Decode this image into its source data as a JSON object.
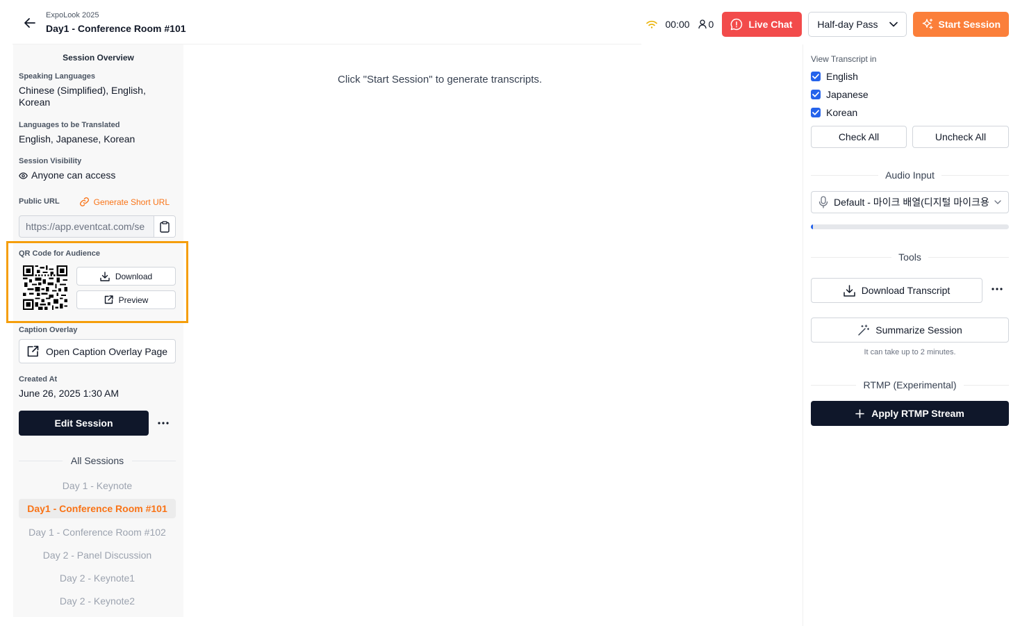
{
  "header": {
    "event_name": "ExpoLook 2025",
    "session_title": "Day1 - Conference Room #101",
    "timer": "00:00",
    "viewer_count": "0",
    "live_chat_label": "Live Chat",
    "pass_select_value": "Half-day Pass",
    "start_session_label": "Start Session",
    "icons": [
      "back-arrow-icon",
      "wifi-icon",
      "user-icon",
      "chat-icon",
      "chevron-down-icon",
      "sparkle-icon"
    ],
    "colors": {
      "live_chat": "#f24b4b",
      "start_session": "#fb7f3a"
    }
  },
  "sidebar": {
    "title": "Session Overview",
    "speaking_languages_label": "Speaking Languages",
    "speaking_languages_value": "Chinese (Simplified), English, Korean",
    "translated_languages_label": "Languages to be Translated",
    "translated_languages_value": "English, Japanese, Korean",
    "visibility_label": "Session Visibility",
    "visibility_value": "Anyone can access",
    "public_url_label": "Public URL",
    "generate_short_url_label": "Generate Short URL",
    "public_url_value": "https://app.eventcat.com/se",
    "qr_label": "QR Code for Audience",
    "qr_download_label": "Download",
    "qr_preview_label": "Preview",
    "caption_overlay_label": "Caption Overlay",
    "caption_overlay_button": "Open Caption Overlay Page",
    "created_at_label": "Created At",
    "created_at_value": "June 26, 2025 1:30 AM",
    "edit_session_label": "Edit Session",
    "all_sessions_label": "All Sessions",
    "sessions": [
      {
        "label": "Day 1 - Keynote",
        "active": false
      },
      {
        "label": "Day1 - Conference Room #101",
        "active": true
      },
      {
        "label": "Day 1 - Conference Room #102",
        "active": false
      },
      {
        "label": "Day 2 - Panel Discussion",
        "active": false
      },
      {
        "label": "Day 2 - Keynote1",
        "active": false
      },
      {
        "label": "Day 2 - Keynote2",
        "active": false
      }
    ],
    "colors": {
      "accent": "#f97316",
      "qr_highlight": "#f59e0b"
    }
  },
  "main": {
    "empty_message": "Click \"Start Session\" to generate transcripts."
  },
  "right_panel": {
    "view_transcript_label": "View Transcript in",
    "languages": [
      {
        "label": "English",
        "checked": true
      },
      {
        "label": "Japanese",
        "checked": true
      },
      {
        "label": "Korean",
        "checked": true
      }
    ],
    "check_all_label": "Check All",
    "uncheck_all_label": "Uncheck All",
    "audio_input_label": "Audio Input",
    "audio_input_value": "Default - 마이크 배열(디지털 마이크용...",
    "audio_level": 0.01,
    "tools_label": "Tools",
    "download_transcript_label": "Download Transcript",
    "summarize_session_label": "Summarize Session",
    "summarize_note": "It can take up to 2 minutes.",
    "rtmp_label": "RTMP (Experimental)",
    "apply_rtmp_label": "Apply RTMP Stream",
    "colors": {
      "checkbox": "#2563eb",
      "rtmp_button": "#0f172a"
    }
  }
}
